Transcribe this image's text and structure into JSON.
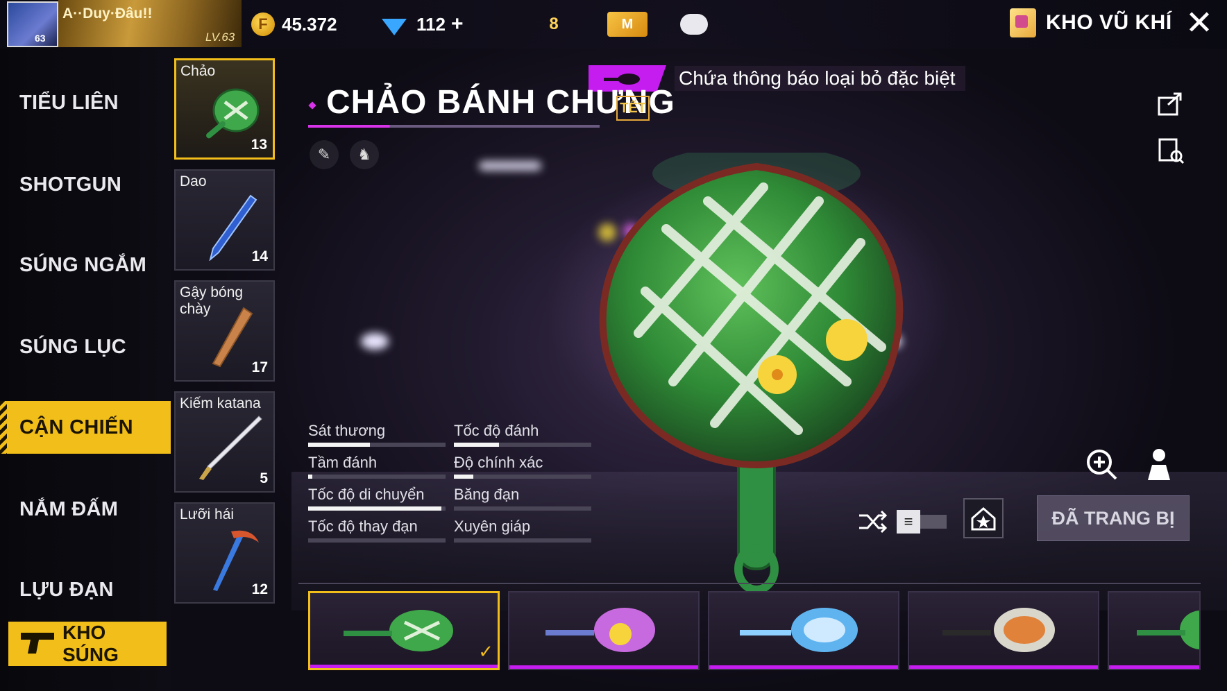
{
  "player": {
    "name": "A··Duy·Đâu!!",
    "avatar_level": "63",
    "level_label": "LV.63"
  },
  "currency": {
    "coins": "45.372",
    "coin_symbol": "F",
    "diamonds": "112",
    "add_symbol": "+"
  },
  "header_badges": {
    "rank_badge": "8",
    "membership_badge": "M"
  },
  "header": {
    "title": "KHO VŨ KHÍ",
    "close_symbol": "✕"
  },
  "categories": [
    {
      "label": "TIỂU LIÊN",
      "active": false
    },
    {
      "label": "SHOTGUN",
      "active": false
    },
    {
      "label": "SÚNG NGẮM",
      "active": false
    },
    {
      "label": "SÚNG LỤC",
      "active": false
    },
    {
      "label": "CẬN CHIẾN",
      "active": true
    },
    {
      "label": "NẮM ĐẤM",
      "active": false
    },
    {
      "label": "LỰU ĐẠN",
      "active": false
    }
  ],
  "bottom_tab": {
    "label": "KHO SÚNG"
  },
  "weapons": [
    {
      "label": "Chảo",
      "count": "13",
      "selected": true
    },
    {
      "label": "Dao",
      "count": "14",
      "selected": false
    },
    {
      "label": "Gậy bóng chày",
      "count": "17",
      "selected": false
    },
    {
      "label": "Kiếm katana",
      "count": "5",
      "selected": false
    },
    {
      "label": "Lưỡi hái",
      "count": "12",
      "selected": false
    }
  ],
  "detail": {
    "notice": "Chứa thông báo loại bỏ đặc biệt",
    "title": "CHẢO BÁNH CHƯNG",
    "tag": "TẾT"
  },
  "stats": [
    {
      "label": "Sát thương",
      "level": 0.45
    },
    {
      "label": "Tốc độ đánh",
      "level": 0.33
    },
    {
      "label": "Tầm đánh",
      "level": 0.03
    },
    {
      "label": "Độ chính xác",
      "level": 0.14
    },
    {
      "label": "Tốc độ di chuyển",
      "level": 0.97
    },
    {
      "label": "Băng đạn",
      "level": 0.0
    },
    {
      "label": "Tốc độ thay đạn",
      "level": 0.0
    },
    {
      "label": "Xuyên giáp",
      "level": 0.0
    }
  ],
  "equip_button": {
    "label": "ĐÃ TRANG BỊ"
  },
  "skins": [
    {
      "name": "banh-chung-pan",
      "selected": true
    },
    {
      "name": "cartoon-pan",
      "selected": false
    },
    {
      "name": "ice-pan",
      "selected": false
    },
    {
      "name": "food-pan",
      "selected": false
    },
    {
      "name": "partial-pan",
      "selected": false
    }
  ],
  "colors": {
    "accent": "#f2be1a",
    "highlight": "#c51cf0",
    "stat_fill": "#f4f4f4"
  }
}
